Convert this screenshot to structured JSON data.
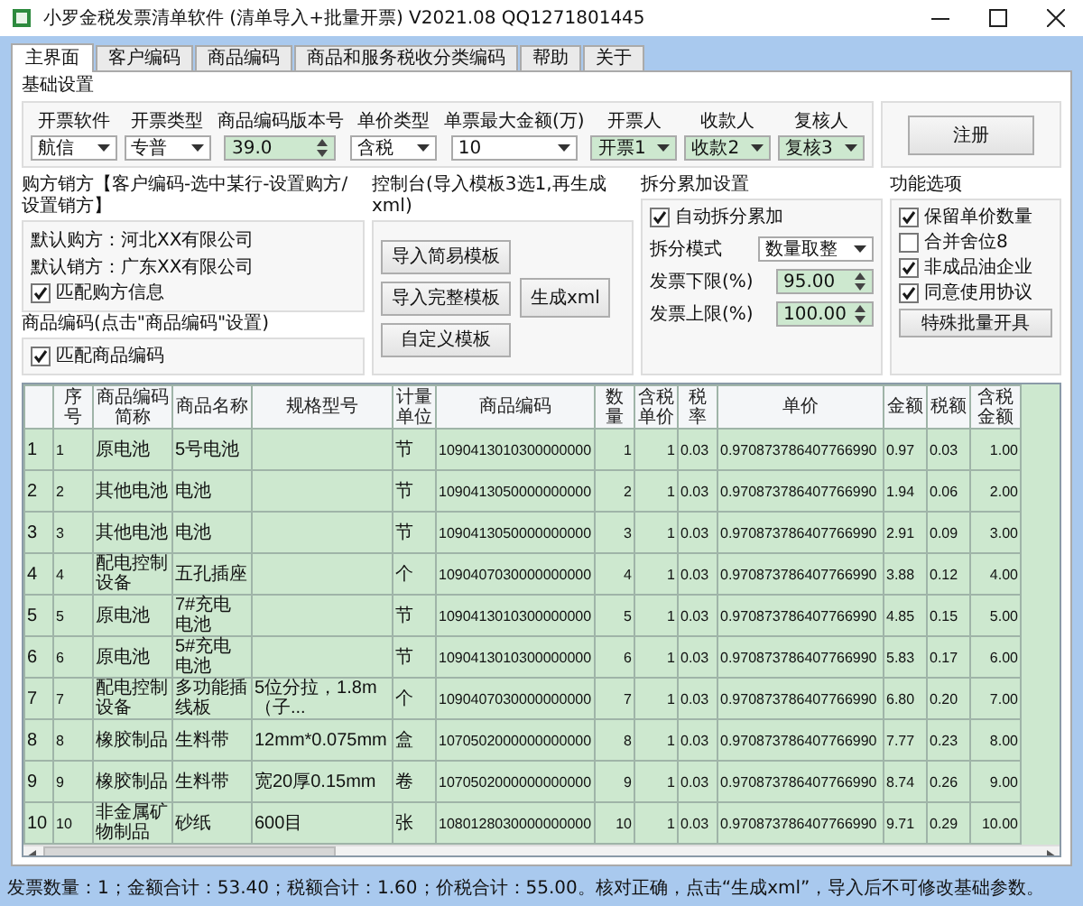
{
  "window": {
    "title": "小罗金税发票清单软件 (清单导入+批量开票) V2021.08 QQ1271801445"
  },
  "tabs": [
    {
      "label": "主界面",
      "selected": true
    },
    {
      "label": "客户编码",
      "selected": false
    },
    {
      "label": "商品编码",
      "selected": false
    },
    {
      "label": "商品和服务税收分类编码",
      "selected": false
    },
    {
      "label": "帮助",
      "selected": false
    },
    {
      "label": "关于",
      "selected": false
    }
  ],
  "basic_settings": {
    "title": "基础设置",
    "fields": [
      {
        "label": "开票软件",
        "value": "航信",
        "kind": "combo",
        "highlighted": false
      },
      {
        "label": "开票类型",
        "value": "专普",
        "kind": "combo",
        "highlighted": false
      },
      {
        "label": "商品编码版本号",
        "value": "39.0",
        "kind": "spin",
        "highlighted": true
      },
      {
        "label": "单价类型",
        "value": "含税",
        "kind": "combo",
        "highlighted": false
      },
      {
        "label": "单票最大金额(万)",
        "value": "10",
        "kind": "combo",
        "highlighted": false
      },
      {
        "label": "开票人",
        "value": "开票1",
        "kind": "combo",
        "highlighted": true
      },
      {
        "label": "收款人",
        "value": "收款2",
        "kind": "combo",
        "highlighted": true
      },
      {
        "label": "复核人",
        "value": "复核3",
        "kind": "combo",
        "highlighted": true
      }
    ],
    "register_button": "注册"
  },
  "buyer_seller": {
    "title": "购方销方【客户编码-选中某行-设置购方/设置销方】",
    "lines": [
      "默认购方：河北XX有限公司",
      "默认销方：广东XX有限公司"
    ],
    "checkbox": {
      "label": "匹配购方信息",
      "checked": true
    }
  },
  "product_code": {
    "title": "商品编码(点击\"商品编码\"设置)",
    "checkbox": {
      "label": "匹配商品编码",
      "checked": true
    }
  },
  "console": {
    "title": "控制台(导入模板3选1,再生成xml)",
    "template_buttons": [
      "导入简易模板",
      "导入完整模板",
      "自定义模板"
    ],
    "generate_button": "生成xml"
  },
  "split_settings": {
    "title": "拆分累加设置",
    "checkbox": {
      "label": "自动拆分累加",
      "checked": true
    },
    "fields": [
      {
        "label": "拆分模式",
        "value": "数量取整",
        "kind": "combo",
        "highlighted": false
      },
      {
        "label": "发票下限(%)",
        "value": "95.00",
        "kind": "spin",
        "highlighted": true
      },
      {
        "label": "发票上限(%)",
        "value": "100.00",
        "kind": "spin",
        "highlighted": true
      }
    ]
  },
  "options": {
    "title": "功能选项",
    "checkboxes": [
      {
        "label": "保留单价数量",
        "checked": true
      },
      {
        "label": "合并舍位8",
        "checked": false
      },
      {
        "label": "非成品油企业",
        "checked": true
      },
      {
        "label": "同意使用协议",
        "checked": true
      }
    ],
    "button": "特殊批量开具"
  },
  "table": {
    "columns": [
      "序号",
      "商品编码简称",
      "商品名称",
      "规格型号",
      "计量单位",
      "商品编码",
      "数量",
      "含税单价",
      "税率",
      "单价",
      "金额",
      "税额",
      "含税金额"
    ],
    "rows": [
      {
        "header": "1",
        "cells": [
          "1",
          "原电池",
          "5号电池",
          "",
          "节",
          "1090413010300000000",
          "1",
          "1",
          "0.03",
          "0.970873786407766990",
          "0.97",
          "0.03",
          "1.00"
        ]
      },
      {
        "header": "2",
        "cells": [
          "2",
          "其他电池",
          "电池",
          "",
          "节",
          "1090413050000000000",
          "2",
          "1",
          "0.03",
          "0.970873786407766990",
          "1.94",
          "0.06",
          "2.00"
        ]
      },
      {
        "header": "3",
        "cells": [
          "3",
          "其他电池",
          "电池",
          "",
          "节",
          "1090413050000000000",
          "3",
          "1",
          "0.03",
          "0.970873786407766990",
          "2.91",
          "0.09",
          "3.00"
        ]
      },
      {
        "header": "4",
        "cells": [
          "4",
          "配电控制设备",
          "五孔插座",
          "",
          "个",
          "1090407030000000000",
          "4",
          "1",
          "0.03",
          "0.970873786407766990",
          "3.88",
          "0.12",
          "4.00"
        ]
      },
      {
        "header": "5",
        "cells": [
          "5",
          "原电池",
          "7#充电电池",
          "",
          "节",
          "1090413010300000000",
          "5",
          "1",
          "0.03",
          "0.970873786407766990",
          "4.85",
          "0.15",
          "5.00"
        ]
      },
      {
        "header": "6",
        "cells": [
          "6",
          "原电池",
          "5#充电电池",
          "",
          "节",
          "1090413010300000000",
          "6",
          "1",
          "0.03",
          "0.970873786407766990",
          "5.83",
          "0.17",
          "6.00"
        ]
      },
      {
        "header": "7",
        "cells": [
          "7",
          "配电控制设备",
          "多功能插线板",
          "5位分拉，1.8m（子...",
          "个",
          "1090407030000000000",
          "7",
          "1",
          "0.03",
          "0.970873786407766990",
          "6.80",
          "0.20",
          "7.00"
        ]
      },
      {
        "header": "8",
        "cells": [
          "8",
          "橡胶制品",
          "生料带",
          "12mm*0.075mm",
          "盒",
          "1070502000000000000",
          "8",
          "1",
          "0.03",
          "0.970873786407766990",
          "7.77",
          "0.23",
          "8.00"
        ]
      },
      {
        "header": "9",
        "cells": [
          "9",
          "橡胶制品",
          "生料带",
          "宽20厚0.15mm",
          "卷",
          "1070502000000000000",
          "9",
          "1",
          "0.03",
          "0.970873786407766990",
          "8.74",
          "0.26",
          "9.00"
        ]
      },
      {
        "header": "10",
        "cells": [
          "10",
          "非金属矿物制品",
          "砂纸",
          "600目",
          "张",
          "1080128030000000000",
          "10",
          "1",
          "0.03",
          "0.970873786407766990",
          "9.71",
          "0.29",
          "10.00"
        ]
      }
    ]
  },
  "status_bar": "发票数量：1；金额合计：53.40；税额合计：1.60；价税合计：55.00。核对正确，点击“生成xml”，导入后不可修改基础参数。"
}
